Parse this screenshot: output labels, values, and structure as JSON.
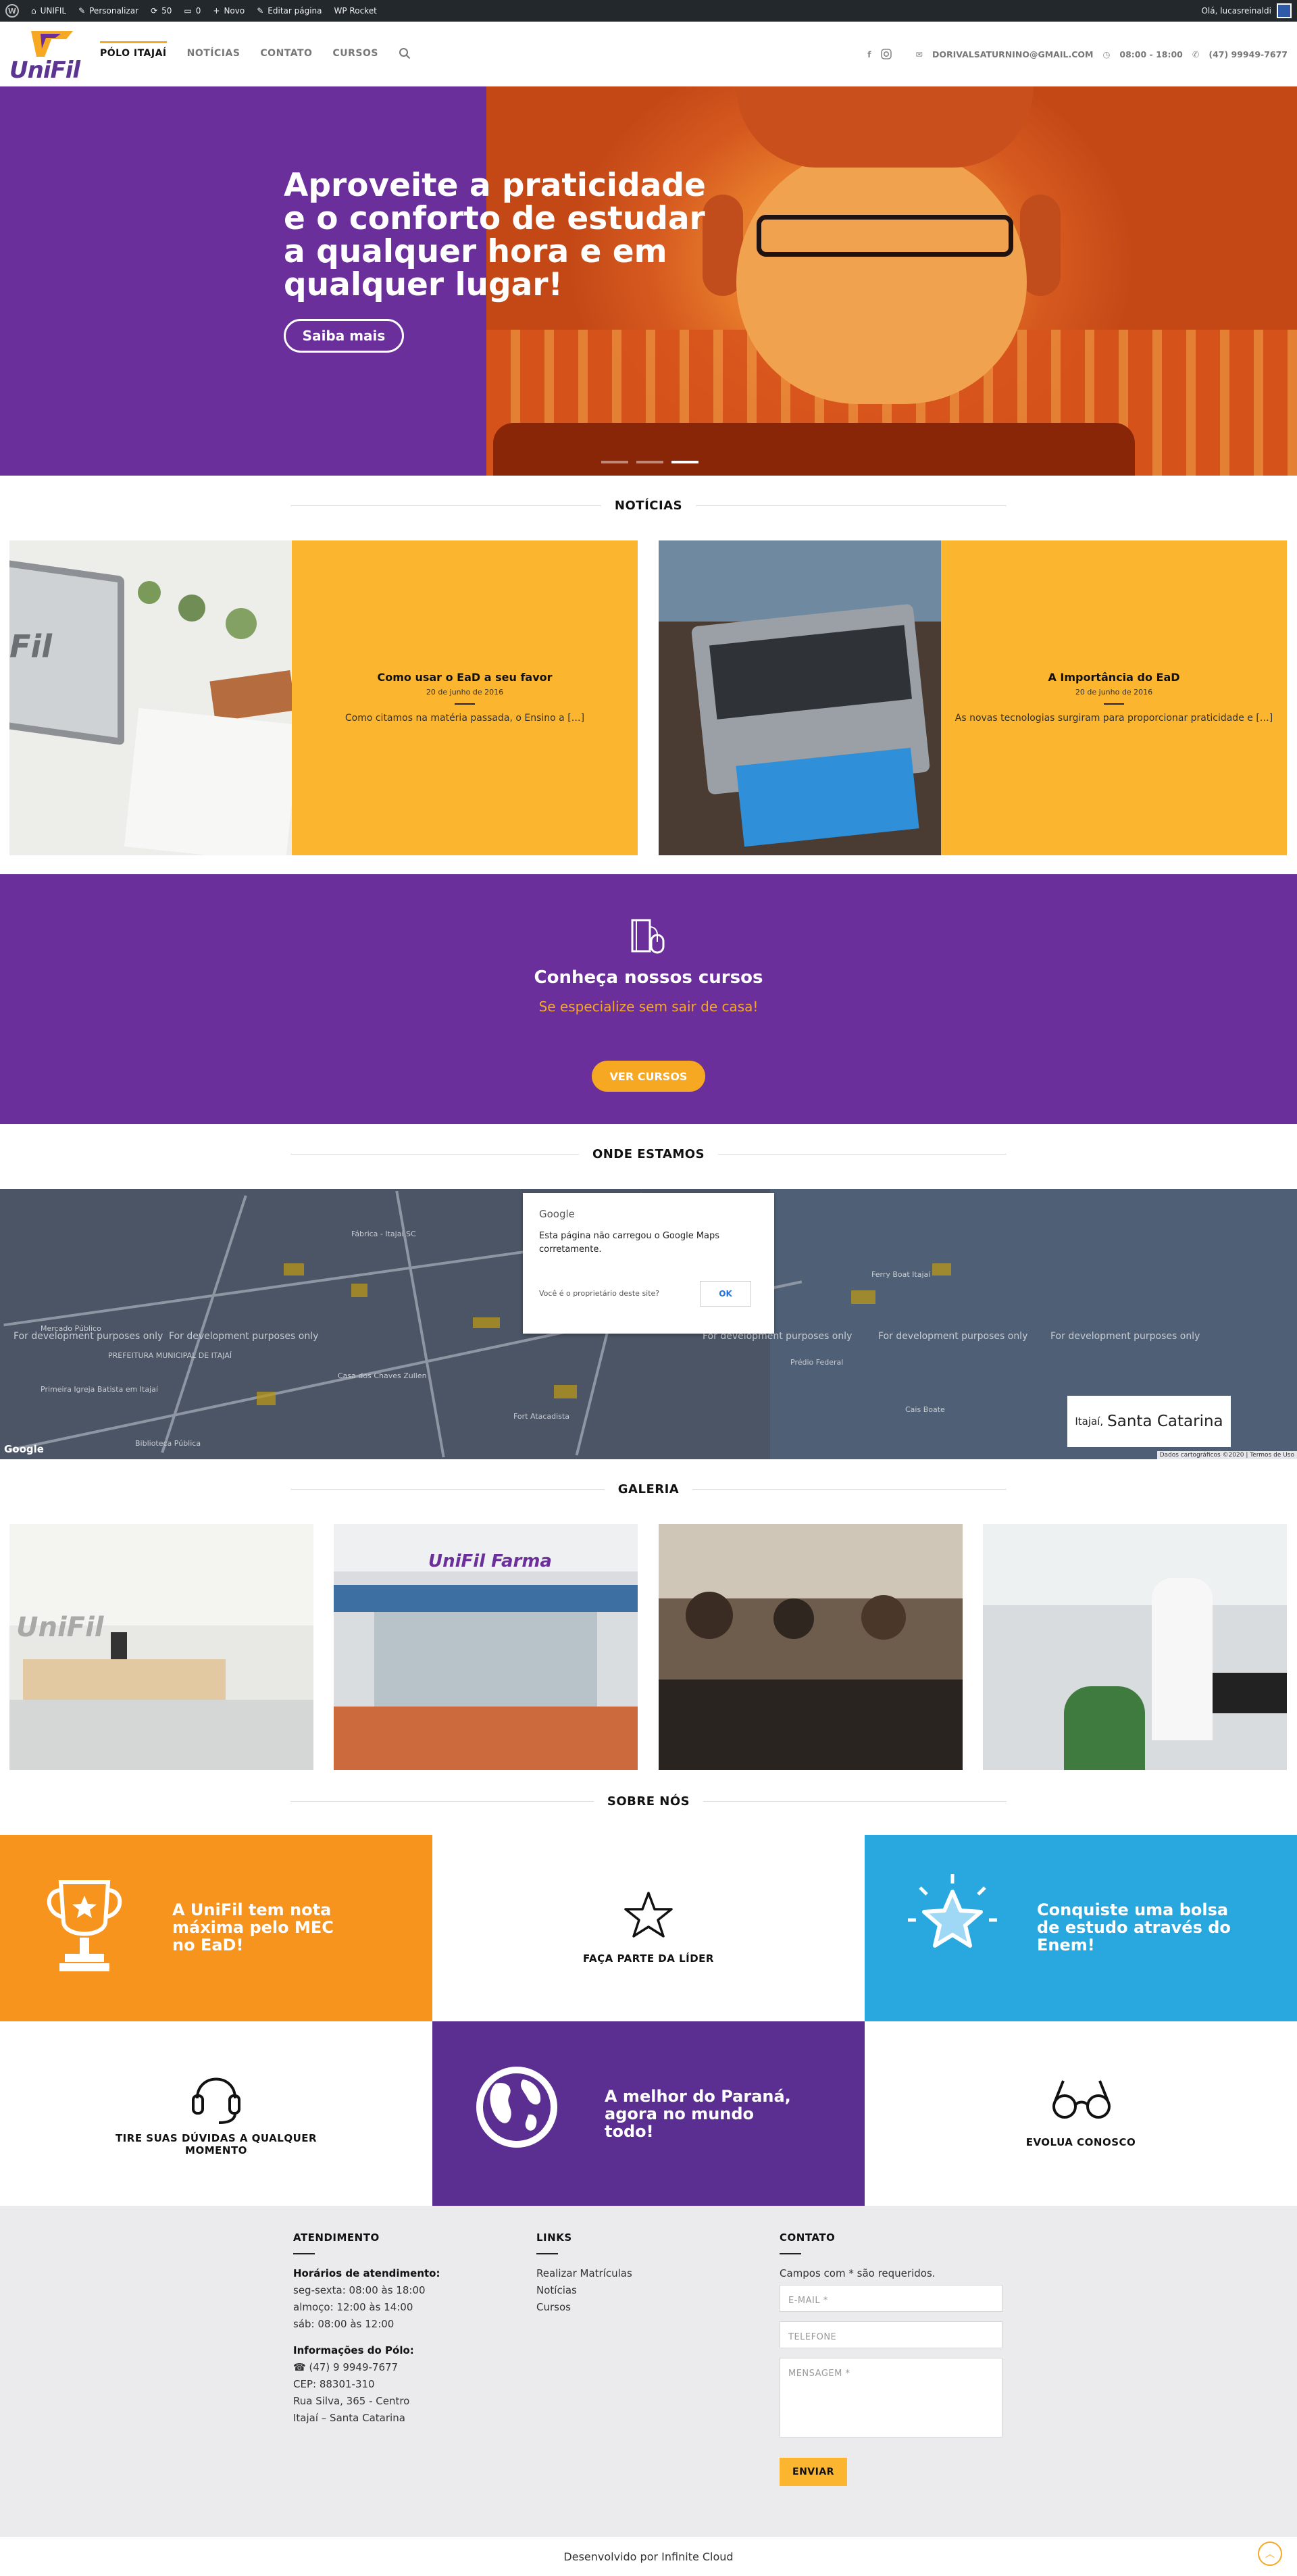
{
  "adminbar": {
    "site": "UNIFIL",
    "customize": "Personalizar",
    "updates": "50",
    "comments": "0",
    "new": "Novo",
    "edit": "Editar página",
    "rocket": "WP Rocket",
    "greeting": "Olá, lucasreinaldi"
  },
  "header": {
    "logo_text": "UniFil",
    "nav": [
      "PÓLO ITAJAÍ",
      "NOTÍCIAS",
      "CONTATO",
      "CURSOS"
    ],
    "email": "DORIVALSATURNINO@GMAIL.COM",
    "hours": "08:00 - 18:00",
    "phone": "(47) 99949-7677"
  },
  "hero": {
    "title": "Aproveite a praticidade e o conforto de estudar a qualquer hora e em qualquer lugar!",
    "button": "Saiba mais",
    "active_slide": 3
  },
  "news": {
    "title": "NOTÍCIAS",
    "items": [
      {
        "title": "Como usar o EaD a seu favor",
        "date": "20 de junho de 2016",
        "excerpt": "Como citamos na matéria passada, o Ensino a […]"
      },
      {
        "title": "A Importância do EaD",
        "date": "20 de junho de 2016",
        "excerpt": "As novas tecnologias surgiram para proporcionar praticidade e […]"
      }
    ],
    "card1_logo": "Fil"
  },
  "courses": {
    "title": "Conheça nossos cursos",
    "subtitle": "Se especialize sem sair de casa!",
    "button": "VER CURSOS"
  },
  "location": {
    "title": "ONDE ESTAMOS",
    "dialog_brand": "Google",
    "dialog_msg": "Esta página não carregou o Google Maps corretamente.",
    "dialog_q": "Você é o proprietário deste site?",
    "dialog_ok": "OK",
    "city": "Itajaí,",
    "state": "Santa Catarina",
    "dev_notice": "For development purposes only",
    "google": "Google",
    "attribution": "Dados cartográficos ©2020 | Termos de Uso",
    "labels": [
      "Fábrica - Itajaí SC",
      "Ferry Boat Itajaí",
      "Prédio Federal",
      "Cais Boate",
      "Mercado Público",
      "PREFEITURA MUNICIPAL DE ITAJAÍ",
      "Casa dos Chaves Zullen",
      "Fort Atacadista",
      "Biblioteca Pública",
      "Primeira Igreja Batista em Itajaí"
    ]
  },
  "gallery": {
    "title": "GALERIA",
    "sign": "UniFil Farma",
    "wall": "UniFil"
  },
  "about": {
    "title": "SOBRE NÓS",
    "cells": [
      "A UniFil tem nota máxima pelo MEC no EaD!",
      "FAÇA PARTE DA LÍDER",
      "Conquiste uma bolsa de estudo através do Enem!",
      "TIRE SUAS DÚVIDAS A QUALQUER MOMENTO",
      "A melhor do Paraná, agora no mundo todo!",
      "EVOLUA CONOSCO"
    ]
  },
  "footer": {
    "atendimento": {
      "title": "ATENDIMENTO",
      "hours_title": "Horários de atendimento:",
      "hours": [
        "seg-sexta: 08:00 às 18:00",
        "almoço: 12:00 às 14:00",
        "sáb: 08:00 às 12:00"
      ],
      "info_title": "Informações do Pólo:",
      "info": [
        "☎ (47) 9 9949-7677",
        "CEP: 88301-310",
        "Rua Silva, 365 - Centro",
        "Itajaí – Santa Catarina"
      ]
    },
    "links": {
      "title": "LINKS",
      "items": [
        "Realizar Matrículas",
        "Notícias",
        "Cursos"
      ]
    },
    "contato": {
      "title": "CONTATO",
      "note": "Campos com * são requeridos.",
      "email": "E-MAIL *",
      "phone": "TELEFONE",
      "message": "MENSAGEM *",
      "send": "ENVIAR"
    },
    "credits": "Desenvolvido por Infinite Cloud"
  },
  "colors": {
    "purple": "#6a2f9b",
    "orange": "#f7a823",
    "yellow": "#fbb52e",
    "blue": "#29a8e0"
  }
}
